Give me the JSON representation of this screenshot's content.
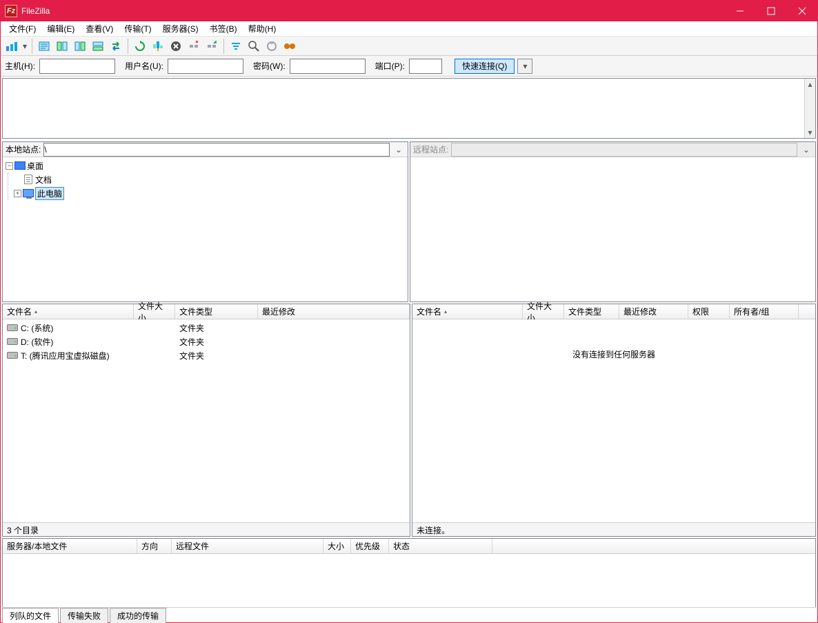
{
  "window": {
    "title": "FileZilla"
  },
  "menu": [
    "文件(F)",
    "编辑(E)",
    "查看(V)",
    "传输(T)",
    "服务器(S)",
    "书签(B)",
    "帮助(H)"
  ],
  "quickbar": {
    "host_label": "主机(H):",
    "user_label": "用户名(U):",
    "pass_label": "密码(W):",
    "port_label": "端口(P):",
    "host": "",
    "user": "",
    "pass": "",
    "port": "",
    "connect_label": "快速连接(Q)"
  },
  "local": {
    "site_label": "本地站点:",
    "path": "\\",
    "tree": [
      {
        "label": "桌面",
        "icon": "desktop",
        "expander": "minus",
        "indent": 0
      },
      {
        "label": "文档",
        "icon": "doc",
        "expander": "none",
        "indent": 1
      },
      {
        "label": "此电脑",
        "icon": "pc",
        "expander": "plus",
        "indent": 1,
        "selected": true
      }
    ],
    "columns": {
      "name": "文件名",
      "size": "文件大小",
      "type": "文件类型",
      "modified": "最近修改"
    },
    "rows": [
      {
        "name": "C: (系统)",
        "type": "文件夹"
      },
      {
        "name": "D: (软件)",
        "type": "文件夹"
      },
      {
        "name": "T: (腾讯应用宝虚拟磁盘)",
        "type": "文件夹"
      }
    ],
    "status": "3 个目录"
  },
  "remote": {
    "site_label": "远程站点:",
    "columns": {
      "name": "文件名",
      "size": "文件大小",
      "type": "文件类型",
      "modified": "最近修改",
      "perm": "权限",
      "owner": "所有者/组"
    },
    "empty_msg": "没有连接到任何服务器",
    "status": "未连接。"
  },
  "queue": {
    "columns": {
      "server": "服务器/本地文件",
      "dir": "方向",
      "remote": "远程文件",
      "size": "大小",
      "prio": "优先级",
      "status": "状态"
    }
  },
  "tabs": [
    "列队的文件",
    "传输失败",
    "成功的传输"
  ]
}
